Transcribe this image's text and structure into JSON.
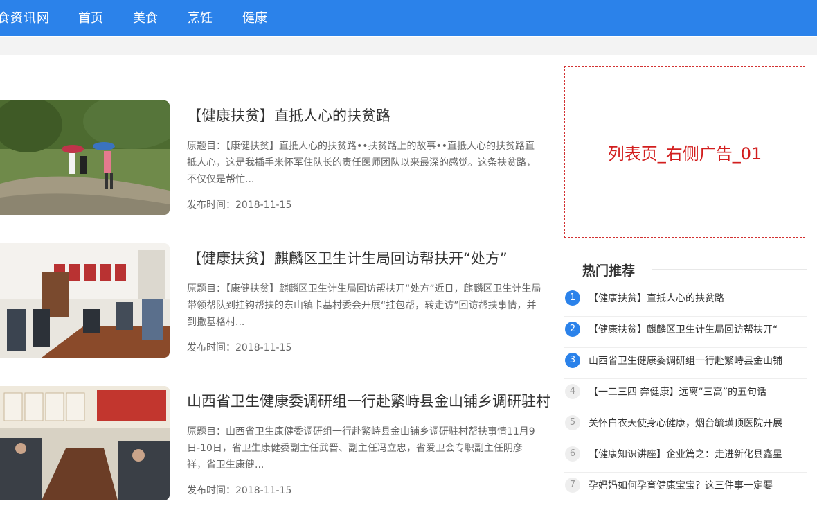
{
  "header": {
    "brand": "食资讯网",
    "nav": [
      "首页",
      "美食",
      "烹饪",
      "健康"
    ]
  },
  "articles": [
    {
      "title": "【健康扶贫】直抵人心的扶贫路",
      "summary": "原题目：【康健扶贫】直抵人心的扶贫路••扶贫路上的故事••直抵人心的扶贫路直抵人心，这是我插手米怀军住队长的责任医师团队以来最深的感觉。这条扶贫路，不仅仅是帮忙...",
      "date": "发布时间：2018-11-15"
    },
    {
      "title": "【健康扶贫】麒麟区卫生计生局回访帮扶开“处方”",
      "summary": "原题目：【康健扶贫】麒麟区卫生计生局回访帮扶开“处方”近日，麒麟区卫生计生局带领帮队到挂钩帮扶的东山镇卡基村委会开展“挂包帮，转走访”回访帮扶事情，并到撒基格村...",
      "date": "发布时间：2018-11-15"
    },
    {
      "title": "山西省卫生健康委调研组一行赴繁峙县金山铺乡调研驻村",
      "summary": "原题目：山西省卫生康健委调研组一行赴繁峙县金山铺乡调研驻村帮扶事情11月9日-10日，省卫生康健委副主任武晋、副主任冯立忠，省爱卫会专职副主任阴彦祥，省卫生康健...",
      "date": "发布时间：2018-11-15"
    }
  ],
  "ad": {
    "label": "列表页_右侧广告_01"
  },
  "hot": {
    "title": "热门推荐",
    "items": [
      {
        "num": "1",
        "text": "【健康扶贫】直抵人心的扶贫路"
      },
      {
        "num": "2",
        "text": "【健康扶贫】麒麟区卫生计生局回访帮扶开“"
      },
      {
        "num": "3",
        "text": "山西省卫生健康委调研组一行赴繁峙县金山铺"
      },
      {
        "num": "4",
        "text": "【一二三四 奔健康】远离“三高”的五句话"
      },
      {
        "num": "5",
        "text": "关怀白衣天使身心健康，烟台毓璜顶医院开展"
      },
      {
        "num": "6",
        "text": "【健康知识讲座】企业篇之：走进新化县鑫星"
      },
      {
        "num": "7",
        "text": "孕妈妈如何孕育健康宝宝？这三件事一定要"
      }
    ]
  },
  "colors": {
    "accent": "#2b82ea",
    "ad_red": "#d21e1e"
  }
}
